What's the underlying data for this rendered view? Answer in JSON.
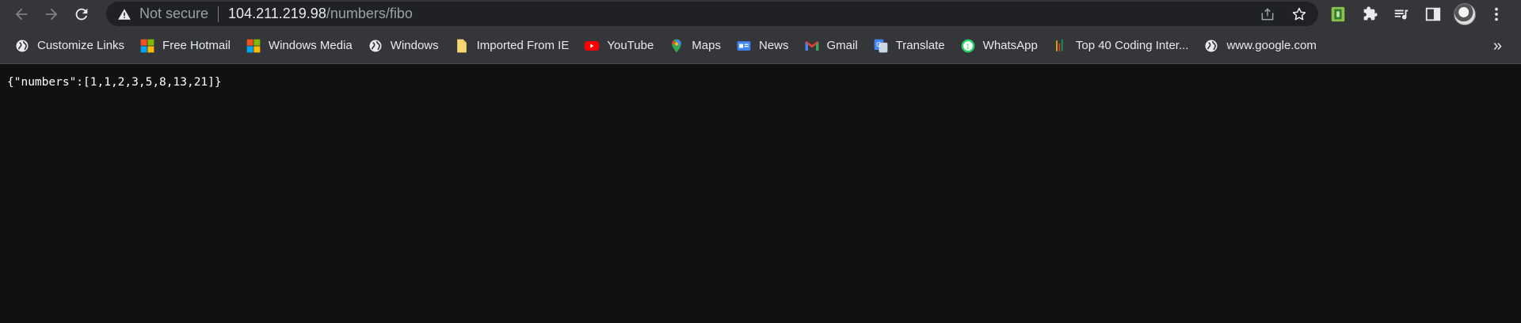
{
  "browser": {
    "security_label": "Not secure",
    "url_host": "104.211.219.98",
    "url_path": "/numbers/fibo"
  },
  "bookmarks": [
    {
      "label": "Customize Links",
      "icon": "globe-icon"
    },
    {
      "label": "Free Hotmail",
      "icon": "microsoft-icon"
    },
    {
      "label": "Windows Media",
      "icon": "microsoft-icon"
    },
    {
      "label": "Windows",
      "icon": "globe-icon"
    },
    {
      "label": "Imported From IE",
      "icon": "folder-icon"
    },
    {
      "label": "YouTube",
      "icon": "youtube-icon"
    },
    {
      "label": "Maps",
      "icon": "maps-icon"
    },
    {
      "label": "News",
      "icon": "news-icon"
    },
    {
      "label": "Gmail",
      "icon": "gmail-icon"
    },
    {
      "label": "Translate",
      "icon": "translate-icon"
    },
    {
      "label": "WhatsApp",
      "icon": "whatsapp-icon"
    },
    {
      "label": "Top 40 Coding Inter...",
      "icon": "chart-bars-icon"
    },
    {
      "label": "www.google.com",
      "icon": "globe-icon"
    }
  ],
  "more_bookmarks": "»",
  "page": {
    "json_text": "{\"numbers\":[1,1,2,3,5,8,13,21]}"
  },
  "colors": {
    "toolbar_bg": "#35363a",
    "omnibox_bg": "#202124",
    "page_bg": "#111111",
    "text": "#e8eaed",
    "muted": "#9aa0a6"
  }
}
